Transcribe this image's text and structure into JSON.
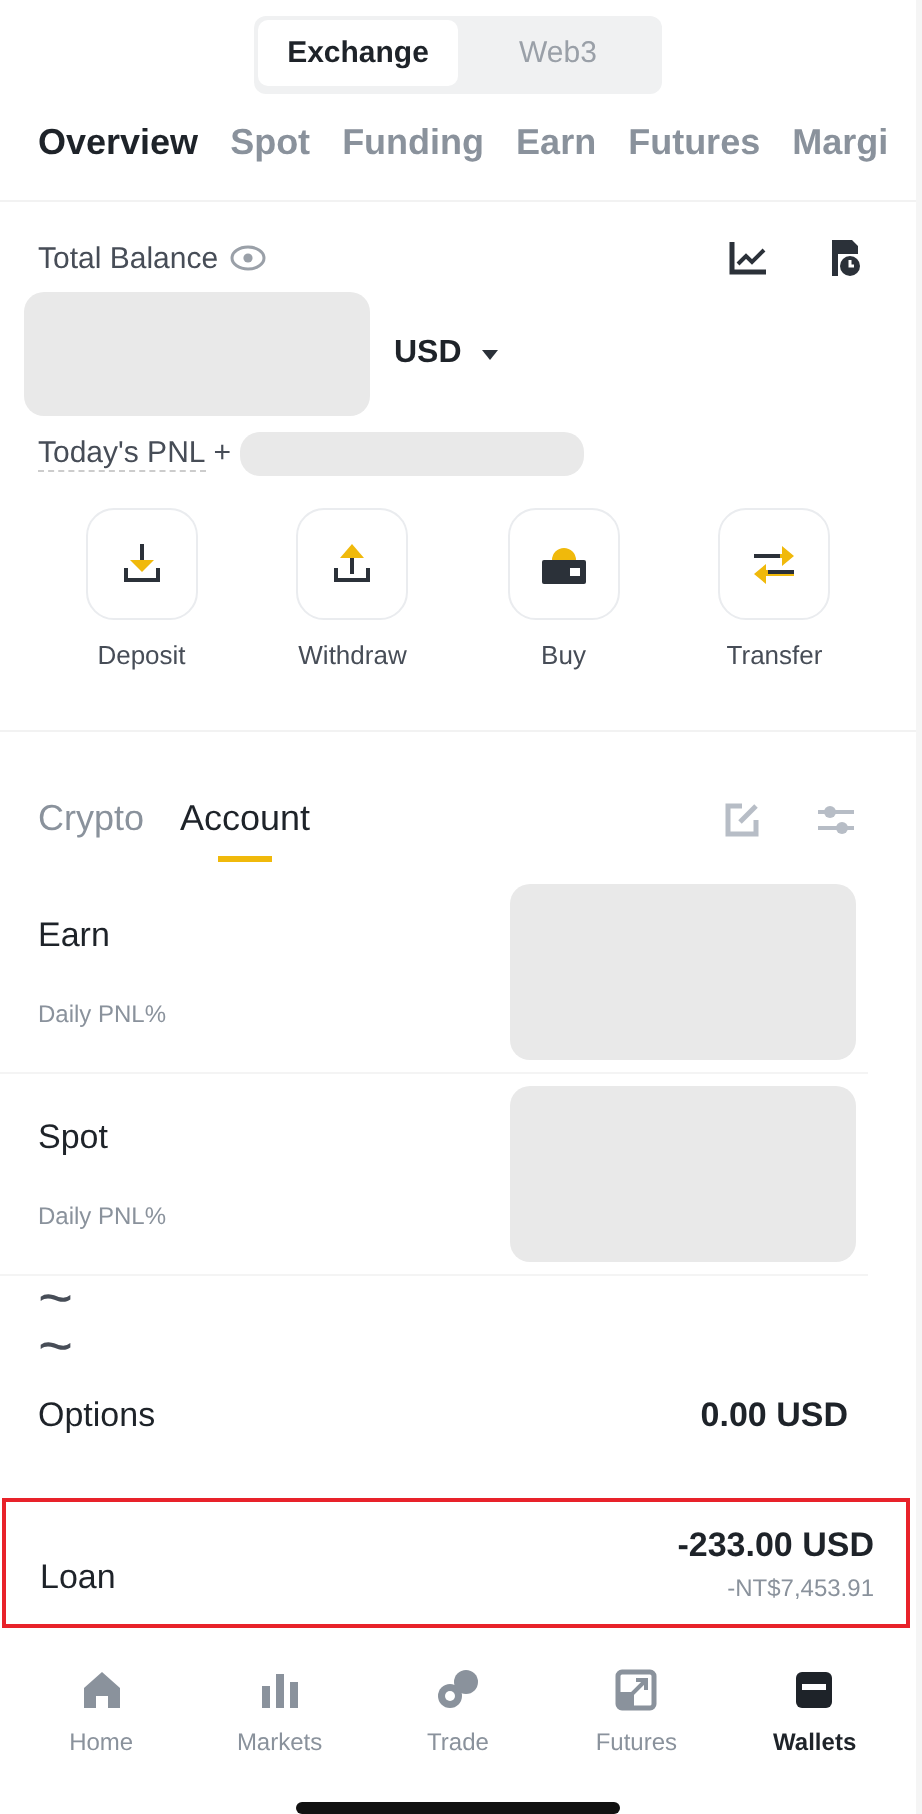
{
  "segment": [
    {
      "label": "Exchange",
      "selected": true
    },
    {
      "label": "Web3",
      "selected": false
    }
  ],
  "tabs": [
    {
      "label": "Overview",
      "selected": true
    },
    {
      "label": "Spot",
      "selected": false
    },
    {
      "label": "Funding",
      "selected": false
    },
    {
      "label": "Earn",
      "selected": false
    },
    {
      "label": "Futures",
      "selected": false
    },
    {
      "label": "Margi",
      "selected": false
    }
  ],
  "balance": {
    "label": "Total Balance",
    "currency": "USD",
    "pnl_label": "Today's PNL",
    "pnl_sign": "+"
  },
  "actions": [
    {
      "label": "Deposit",
      "kind": "deposit"
    },
    {
      "label": "Withdraw",
      "kind": "withdraw"
    },
    {
      "label": "Buy",
      "kind": "buy"
    },
    {
      "label": "Transfer",
      "kind": "transfer"
    }
  ],
  "account_tabs": [
    {
      "label": "Crypto",
      "selected": false
    },
    {
      "label": "Account",
      "selected": true
    }
  ],
  "accounts": [
    {
      "kind": "hidden",
      "name": "Earn",
      "sub": "Daily PNL%"
    },
    {
      "kind": "hidden",
      "name": "Spot",
      "sub": "Daily PNL%"
    },
    {
      "kind": "value",
      "marks": [
        "~",
        "~"
      ],
      "name": "Options",
      "value": "0.00 USD"
    },
    {
      "kind": "highlight",
      "name": "Loan",
      "value": "-233.00 USD",
      "sub": "-NT$7,453.91"
    }
  ],
  "nav": [
    {
      "label": "Home",
      "selected": false
    },
    {
      "label": "Markets",
      "selected": false
    },
    {
      "label": "Trade",
      "selected": false
    },
    {
      "label": "Futures",
      "selected": false
    },
    {
      "label": "Wallets",
      "selected": true
    }
  ]
}
